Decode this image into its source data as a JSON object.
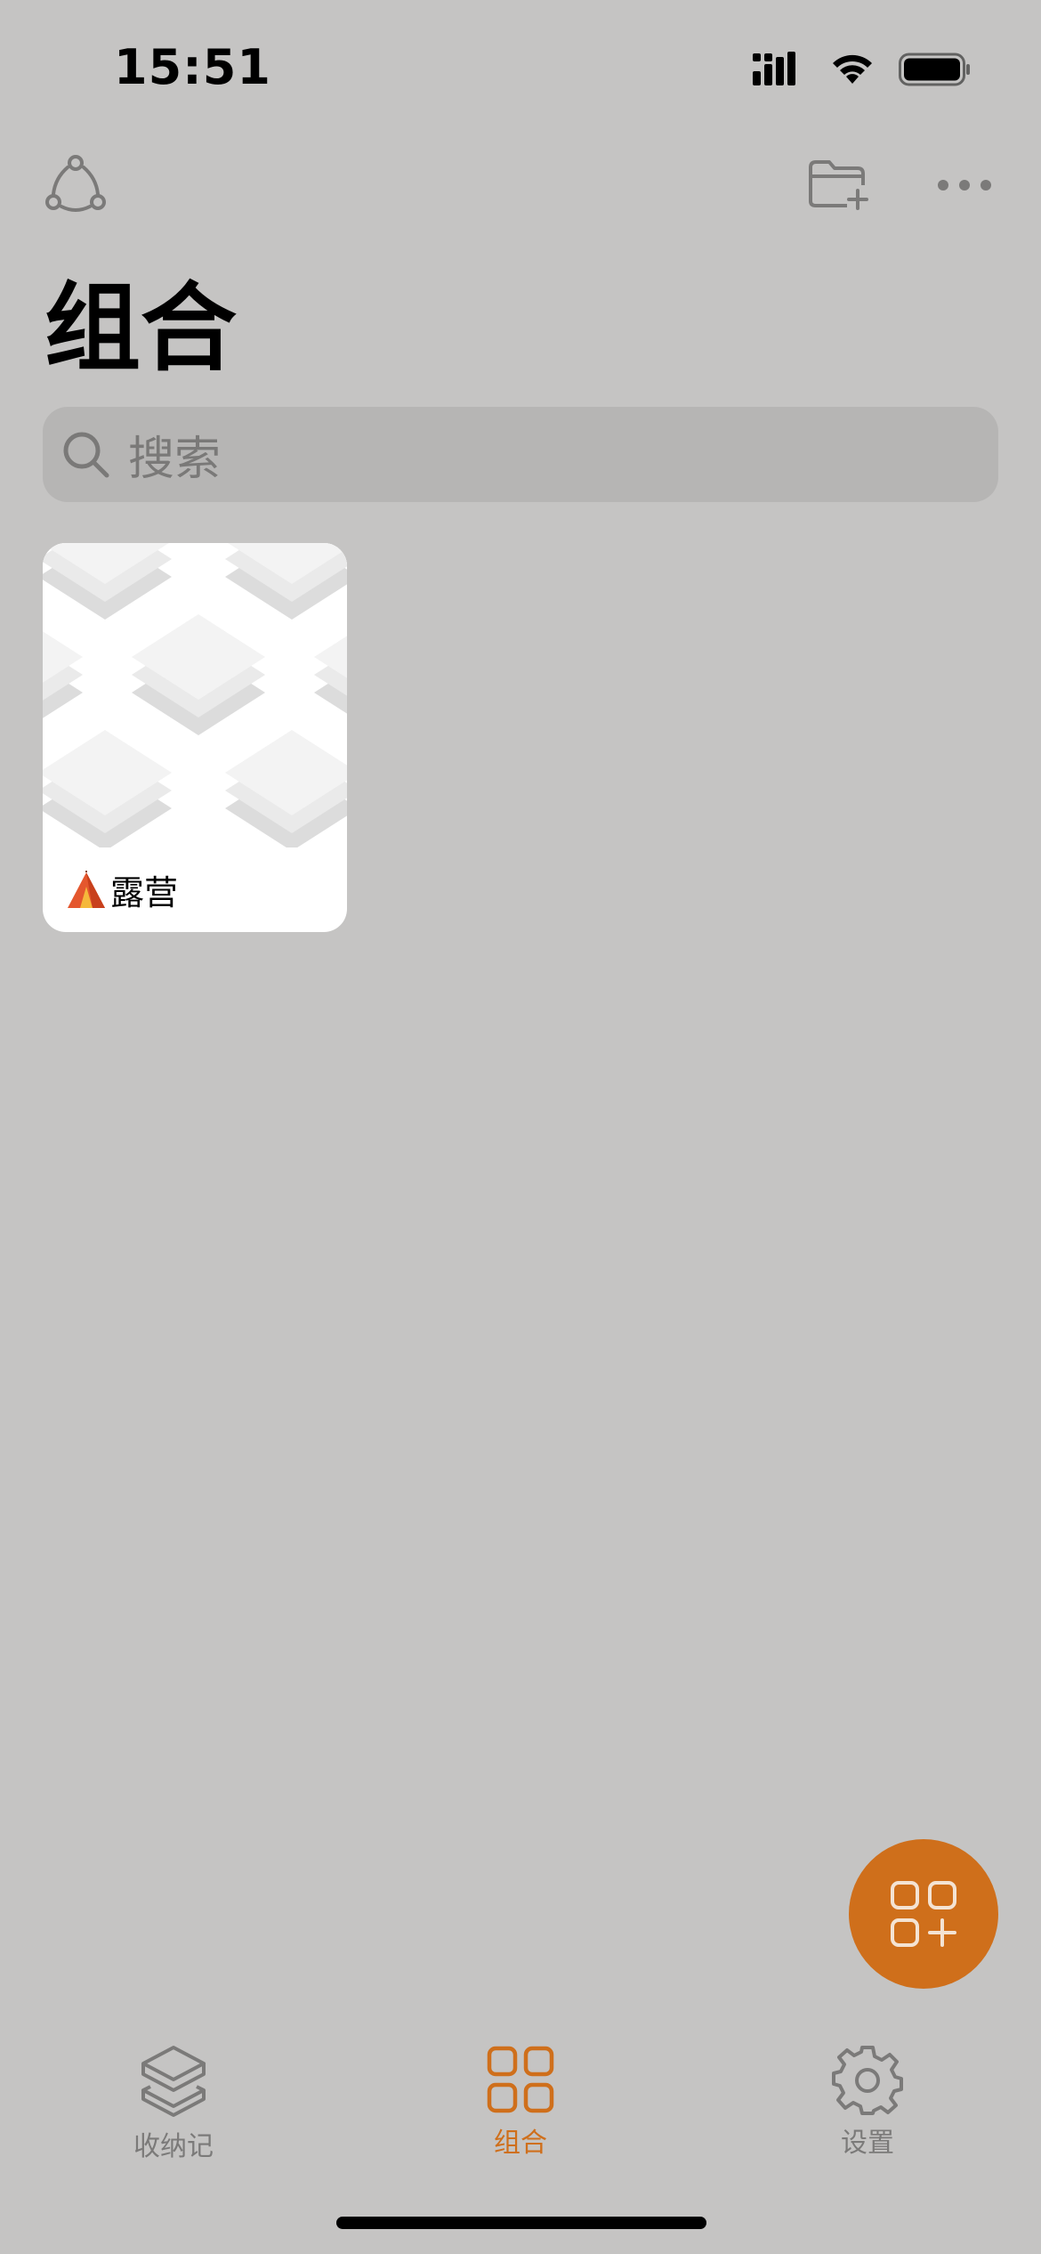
{
  "status_bar": {
    "time": "15:51"
  },
  "header": {
    "title": "组合"
  },
  "search": {
    "placeholder": "搜索"
  },
  "collections": [
    {
      "emoji": "⛺",
      "name": "露营"
    }
  ],
  "tab_bar": {
    "items": [
      {
        "label": "收纳记",
        "active": false
      },
      {
        "label": "组合",
        "active": true
      },
      {
        "label": "设置",
        "active": false
      }
    ]
  },
  "colors": {
    "accent": "#cf6f1b",
    "background": "#c5c4c3",
    "icon_gray": "#7b7a79"
  }
}
